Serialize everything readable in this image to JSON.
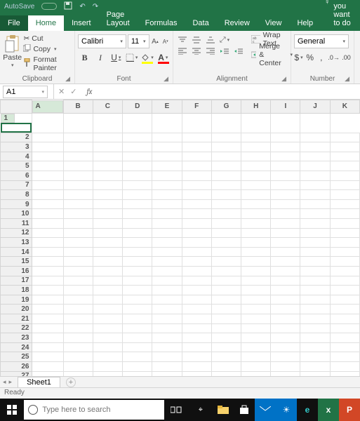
{
  "titlebar": {
    "autosave": "AutoSave"
  },
  "tabs": {
    "file": "File",
    "items": [
      "Home",
      "Insert",
      "Page Layout",
      "Formulas",
      "Data",
      "Review",
      "View",
      "Help"
    ],
    "active": 0,
    "tellme": "Tell me what you want to do"
  },
  "ribbon": {
    "clipboard": {
      "label": "Clipboard",
      "paste": "Paste",
      "cut": "Cut",
      "copy": "Copy",
      "format_painter": "Format Painter"
    },
    "font": {
      "label": "Font",
      "name": "Calibri",
      "size": "11",
      "bold": "B",
      "italic": "I",
      "underline": "U",
      "fill_color": "#ffff00",
      "font_color": "#ff0000",
      "letter_a": "A"
    },
    "alignment": {
      "label": "Alignment",
      "wrap": "Wrap Text",
      "merge": "Merge & Center"
    },
    "number": {
      "label": "Number",
      "format": "General",
      "currency": "$",
      "percent": "%",
      "comma": ","
    }
  },
  "formula_bar": {
    "cell_ref": "A1",
    "cancel": "✕",
    "enter": "✓",
    "fx": "fx",
    "value": ""
  },
  "grid": {
    "columns": [
      "A",
      "B",
      "C",
      "D",
      "E",
      "F",
      "G",
      "H",
      "I",
      "J",
      "K"
    ],
    "rows": 29,
    "selected": {
      "row": 1,
      "col": "A"
    }
  },
  "sheets": {
    "active": "Sheet1"
  },
  "status": "Ready",
  "taskbar": {
    "search_placeholder": "Type here to search"
  }
}
